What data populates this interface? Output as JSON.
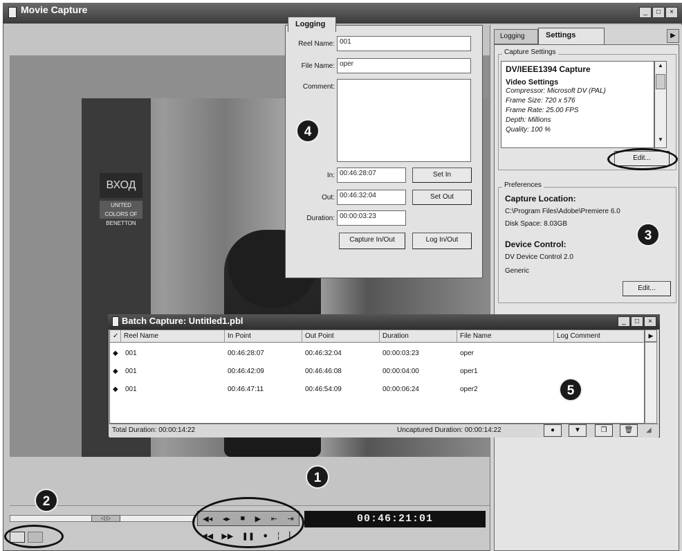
{
  "window": {
    "title": "Movie Capture"
  },
  "logging": {
    "tab": "Logging",
    "reel_name_label": "Reel Name:",
    "reel_name_value": "001",
    "file_name_label": "File Name:",
    "file_name_value": "oper",
    "comment_label": "Comment:",
    "in_label": "In:",
    "in_value": "00:46:28:07",
    "out_label": "Out:",
    "out_value": "00:46:32:04",
    "duration_label": "Duration:",
    "duration_value": "00:00:03:23",
    "set_in": "Set In",
    "set_out": "Set Out",
    "capture_in_out": "Capture In/Out",
    "log_in_out": "Log In/Out"
  },
  "settings": {
    "tab_logging": "Logging",
    "tab_settings": "Settings",
    "capture_group": "Capture Settings",
    "capture_title": "DV/IEEE1394 Capture",
    "video_settings": "Video Settings",
    "lines": [
      "Compressor: Microsoft DV (PAL)",
      "Frame Size: 720 x 576",
      "Frame Rate: 25.00 FPS",
      "Depth: Millions",
      "Quality: 100 %"
    ],
    "edit1": "Edit...",
    "preferences_group": "Preferences",
    "capture_location_title": "Capture Location:",
    "capture_location_path": "C:\\Program Files\\Adobe\\Premiere 6.0",
    "disk_space": "Disk Space: 8.03GB",
    "device_control_title": "Device Control:",
    "device_control": "DV Device Control 2.0",
    "device_generic": "Generic",
    "edit2": "Edit..."
  },
  "video": {
    "sign_exit": "ВХОД",
    "sign_sub": "UNITED COLORS OF BENETTON"
  },
  "controls": {
    "timecode": "00:46:21:01",
    "scrub_handle": "◁ ▷"
  },
  "batch": {
    "title": "Batch Capture: Untitled1.pbl",
    "columns": [
      "✓",
      "Reel Name",
      "In Point",
      "Out Point",
      "Duration",
      "File Name",
      "Log Comment"
    ],
    "rows": [
      {
        "reel": "001",
        "in": "00:46:28:07",
        "out": "00:46:32:04",
        "dur": "00:00:03:23",
        "file": "oper"
      },
      {
        "reel": "001",
        "in": "00:46:42:09",
        "out": "00:46:46:08",
        "dur": "00:00:04:00",
        "file": "oper1"
      },
      {
        "reel": "001",
        "in": "00:46:47:11",
        "out": "00:46:54:09",
        "dur": "00:00:06:24",
        "file": "oper2"
      }
    ],
    "total_duration": "Total Duration: 00:00:14:22",
    "uncaptured_duration": "Uncaptured Duration: 00:00:14:22"
  },
  "badges": [
    "1",
    "2",
    "3",
    "4",
    "5"
  ]
}
